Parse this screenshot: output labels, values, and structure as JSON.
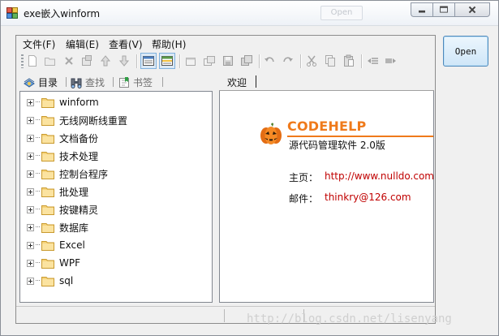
{
  "window": {
    "title": "exe嵌入winform",
    "ghost_button_label": "Open"
  },
  "open_button": {
    "label": "Open"
  },
  "menu": [
    {
      "label": "文件(F)"
    },
    {
      "label": "编辑(E)"
    },
    {
      "label": "查看(V)"
    },
    {
      "label": "帮助(H)"
    }
  ],
  "toolbar": {
    "buttons": [
      "new-icon",
      "open-folder-icon",
      "delete-icon",
      "properties-icon",
      "move-up-icon",
      "move-down-icon",
      "list-view-icon",
      "detail-view-icon",
      "window-icon",
      "copy-window-icon",
      "save-icon",
      "save-all-icon",
      "undo-icon",
      "redo-icon",
      "cut-icon",
      "copy-icon",
      "paste-icon",
      "indent-icon",
      "outdent-icon"
    ]
  },
  "left_tabs": [
    {
      "label": "目录",
      "icon": "catalog-icon",
      "active": true
    },
    {
      "label": "查找",
      "icon": "binoculars-icon",
      "active": false
    },
    {
      "label": "书签",
      "icon": "bookmark-icon",
      "active": false
    }
  ],
  "tree": [
    {
      "label": "winform"
    },
    {
      "label": "无线网断线重置"
    },
    {
      "label": "文档备份"
    },
    {
      "label": "技术处理"
    },
    {
      "label": "控制台程序"
    },
    {
      "label": "批处理"
    },
    {
      "label": "按键精灵"
    },
    {
      "label": "数据库"
    },
    {
      "label": "Excel"
    },
    {
      "label": "WPF"
    },
    {
      "label": "sql"
    }
  ],
  "right_tab": {
    "label": "欢迎"
  },
  "welcome": {
    "brand": "CODEHELP",
    "subtitle": "源代码管理软件   2.0版",
    "homepage_label": "主页：",
    "homepage_value": "http://www.nulldo.com/",
    "email_label": "邮件：",
    "email_value": "thinkry@126.com"
  },
  "watermark": "http://blog.csdn.net/lisenyang",
  "colors": {
    "brand": "#ef7a1b",
    "link": "#c00000",
    "selection": "#dbe9f6"
  }
}
